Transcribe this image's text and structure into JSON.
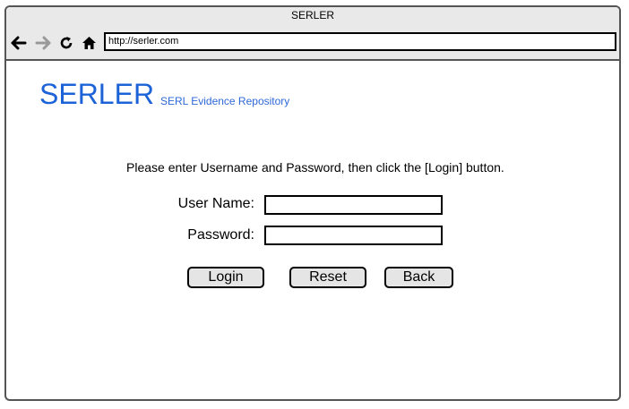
{
  "browser": {
    "window_title": "SERLER",
    "address_url": "http://serler.com",
    "icons": [
      "back-arrow-icon",
      "forward-arrow-icon",
      "reload-icon",
      "home-icon"
    ]
  },
  "header": {
    "logo": "SERLER",
    "tagline": "SERL Evidence Repository"
  },
  "login_form": {
    "instruction": "Please enter Username and Password, then click the [Login] button.",
    "username_label": "User Name:",
    "username_value": "",
    "password_label": "Password:",
    "password_value": ""
  },
  "buttons": {
    "login": "Login",
    "reset": "Reset",
    "back": "Back"
  },
  "colors": {
    "brand": "#1d63d8",
    "titlebar_bg": "#e9e9e9",
    "button_bg": "#e5e5e5"
  }
}
